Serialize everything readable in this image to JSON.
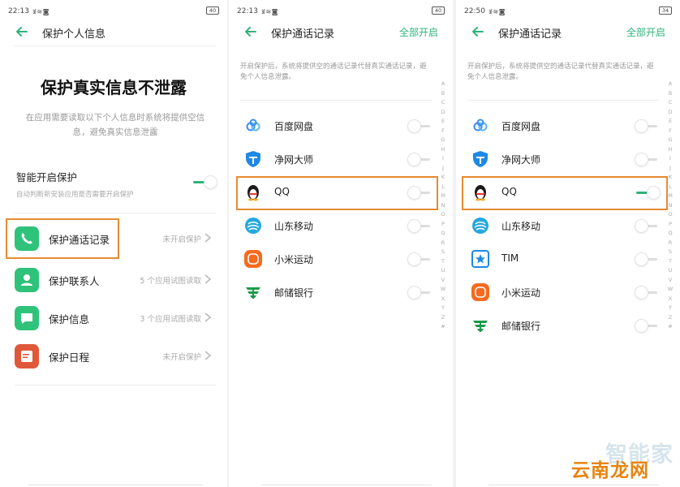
{
  "colors": {
    "accent": "#2fb37a",
    "highlight": "#e58b31",
    "muted": "#aaaaaa"
  },
  "screen1": {
    "status": {
      "time": "22:13",
      "battery": "40"
    },
    "title": "保护个人信息",
    "hero_title": "保护真实信息不泄露",
    "hero_desc": "在应用需要读取以下个人信息时系统将提供空信息，避免真实信息泄露",
    "smart": {
      "title": "智能开启保护",
      "subtitle": "自动判断新安装应用是否需要开启保护",
      "toggle_on": true
    },
    "items": [
      {
        "label": "保护通话记录",
        "status": "未开启保护",
        "icon": "phone-icon",
        "color": "#2fc27a"
      },
      {
        "label": "保护联系人",
        "status": "5 个应用试图读取",
        "icon": "contact-icon",
        "color": "#2fc27a"
      },
      {
        "label": "保护信息",
        "status": "3 个应用试图读取",
        "icon": "message-icon",
        "color": "#2fc27a"
      },
      {
        "label": "保护日程",
        "status": "未开启保护",
        "icon": "calendar-icon",
        "color": "#e0583a"
      }
    ]
  },
  "screen2": {
    "status": {
      "time": "22:13",
      "battery": "40"
    },
    "title": "保护通话记录",
    "action": "全部开启",
    "intro": "开启保护后，系统将提供空的通话记录代替真实通话记录，避免个人信息泄露。",
    "apps": [
      {
        "name": "百度网盘",
        "icon": "baidu-netdisk-icon",
        "on": false
      },
      {
        "name": "净网大师",
        "icon": "jingwang-shield-icon",
        "on": false
      },
      {
        "name": "QQ",
        "icon": "qq-penguin-icon",
        "on": false
      },
      {
        "name": "山东移动",
        "icon": "china-mobile-icon",
        "on": false
      },
      {
        "name": "小米运动",
        "icon": "mi-fit-icon",
        "on": false
      },
      {
        "name": "邮储银行",
        "icon": "postal-bank-icon",
        "on": false
      }
    ]
  },
  "screen3": {
    "status": {
      "time": "22:50",
      "battery": "34"
    },
    "title": "保护通话记录",
    "action": "全部开启",
    "intro": "开启保护后，系统将提供空的通话记录代替真实通话记录，避免个人信息泄露。",
    "apps": [
      {
        "name": "百度网盘",
        "icon": "baidu-netdisk-icon",
        "on": false
      },
      {
        "name": "净网大师",
        "icon": "jingwang-shield-icon",
        "on": false
      },
      {
        "name": "QQ",
        "icon": "qq-penguin-icon",
        "on": true
      },
      {
        "name": "山东移动",
        "icon": "china-mobile-icon",
        "on": false
      },
      {
        "name": "TIM",
        "icon": "tim-star-icon",
        "on": false
      },
      {
        "name": "小米运动",
        "icon": "mi-fit-icon",
        "on": false
      },
      {
        "name": "邮储银行",
        "icon": "postal-bank-icon",
        "on": false
      }
    ]
  },
  "alphabet": [
    "A",
    "B",
    "C",
    "D",
    "E",
    "F",
    "G",
    "H",
    "I",
    "J",
    "K",
    "L",
    "M",
    "N",
    "O",
    "P",
    "Q",
    "R",
    "S",
    "T",
    "U",
    "V",
    "W",
    "X",
    "Y",
    "Z",
    "#"
  ],
  "watermark": {
    "top": "智能家",
    "bottom": "云南龙网"
  }
}
